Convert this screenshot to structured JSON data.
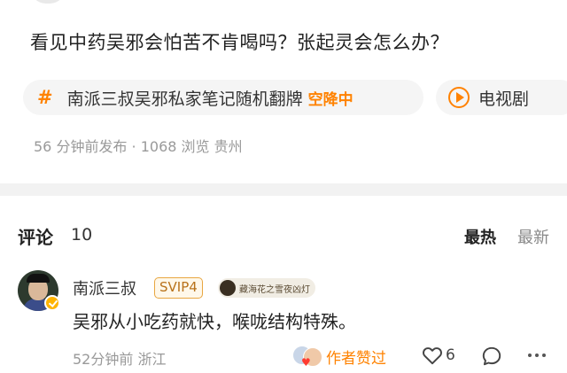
{
  "post": {
    "title": "看见中药吴邪会怕苦不肯喝吗？张起灵会怎么办？",
    "topic_chip": {
      "icon": "hash-icon",
      "label": "南派三叔吴邪私家笔记随机翻牌",
      "tag": "空降中"
    },
    "video_chip": {
      "icon": "play-circle-icon",
      "label": "电视剧"
    },
    "meta": "56 分钟前发布 · 1068 浏览 贵州"
  },
  "comments_section": {
    "title": "评论",
    "count": "10",
    "sort_hot": "最热",
    "sort_new": "最新"
  },
  "comment": {
    "author": "南派三叔",
    "svip_label": "SVIP4",
    "fan_badge_label": "藏海花之雪夜凶灯",
    "text": "吴邪从小吃药就快，喉咙结构特殊。",
    "meta": "52分钟前 浙江",
    "author_liked_label": "作者赞过",
    "like_count": "6"
  },
  "colors": {
    "accent": "#ff8200",
    "divider": "#f2f2f2",
    "meta_text": "#999999"
  }
}
